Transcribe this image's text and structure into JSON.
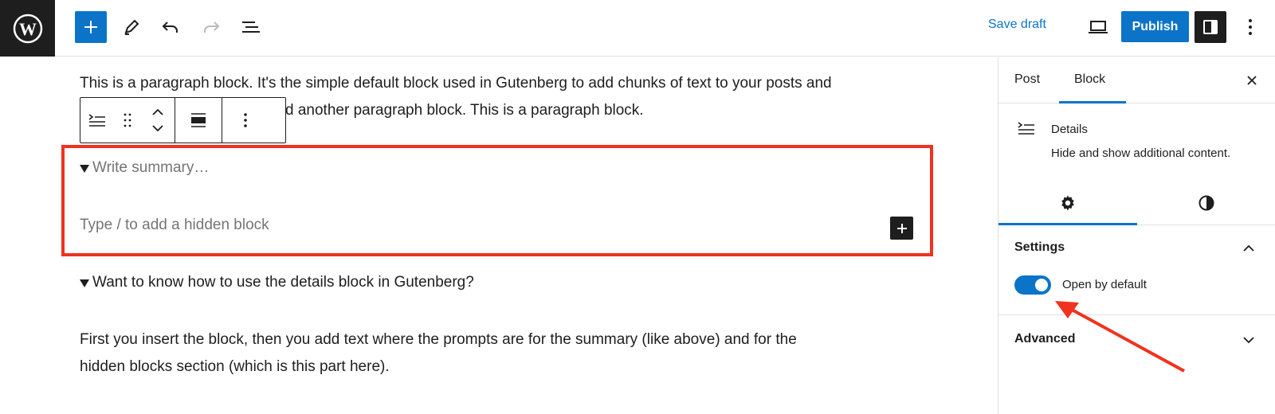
{
  "topbar": {
    "save_draft": "Save draft",
    "publish": "Publish",
    "icons": [
      "wordpress-logo",
      "plus-icon",
      "pencil-icon",
      "undo-icon",
      "redo-icon",
      "list-view-icon",
      "desktop-preview-icon",
      "sidebar-icon",
      "more-vertical-icon"
    ]
  },
  "editor": {
    "paragraph1_line1": "This is a paragraph block. It's the simple default block used in Gutenberg to add chunks of text to your posts and",
    "paragraph1_line2": "d another paragraph block. This is a paragraph block.",
    "details_summary_placeholder": "Write summary…",
    "details_hidden_placeholder": "Type / to add a hidden block",
    "details2_summary": "Want to know how to use the details block in Gutenberg?",
    "paragraph2_line1": "First you insert the block, then you add text where the prompts are for the summary (like above) and for the",
    "paragraph2_line2": "hidden blocks section (which is this part here).",
    "highlight_color": "#f0321e"
  },
  "sidebar": {
    "tabs": [
      {
        "label": "Post"
      },
      {
        "label": "Block",
        "active": true
      }
    ],
    "block_card": {
      "title": "Details",
      "description": "Hide and show additional content."
    },
    "settings_panel": {
      "title": "Settings",
      "toggle_label": "Open by default",
      "toggle_on": true
    },
    "advanced_panel": {
      "title": "Advanced"
    }
  },
  "colors": {
    "accent": "#0b74c9",
    "dark": "#1e1e1e",
    "annotation": "#f0321e"
  }
}
